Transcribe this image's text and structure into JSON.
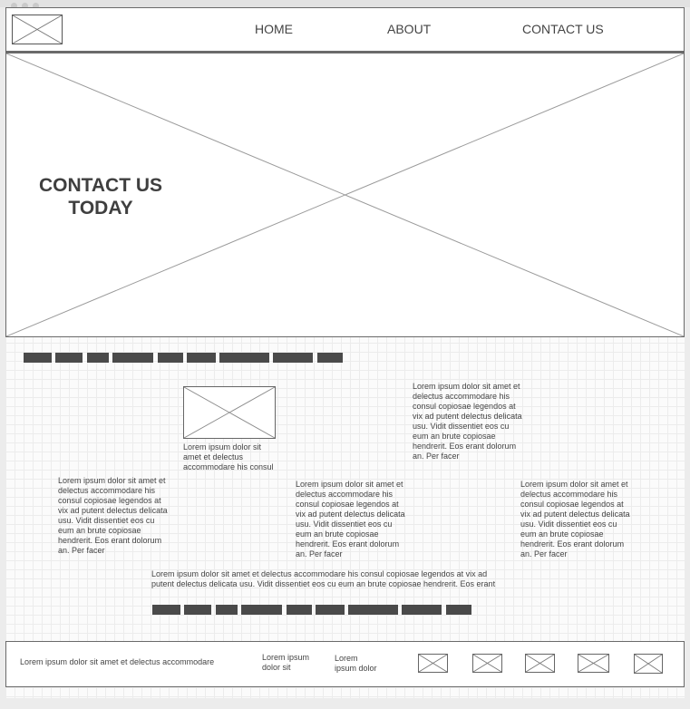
{
  "nav": {
    "home": "HOME",
    "about": "ABOUT",
    "contact": "CONTACT US"
  },
  "hero": {
    "title_line1": "CONTACT US",
    "title_line2": "TODAY"
  },
  "content": {
    "image_caption": "Lorem ipsum dolor sit amet et delectus accommodare his consul",
    "para_top_right": "Lorem ipsum dolor sit amet et delectus accommodare his consul copiosae legendos at vix ad putent delectus delicata usu. Vidit dissentiet eos cu eum an brute copiosae hendrerit. Eos erant dolorum an. Per facer",
    "para_left": "Lorem ipsum dolor sit amet et delectus accommodare his consul copiosae legendos at vix ad putent delectus delicata usu. Vidit dissentiet eos cu eum an brute copiosae hendrerit. Eos erant dolorum an. Per facer",
    "para_middle": "Lorem ipsum dolor sit amet et delectus accommodare his consul copiosae legendos at vix ad putent delectus delicata usu. Vidit dissentiet eos cu eum an brute copiosae hendrerit. Eos erant dolorum an. Per facer",
    "para_right": "Lorem ipsum dolor sit amet et delectus accommodare his consul copiosae legendos at vix ad putent delectus delicata usu. Vidit dissentiet eos cu eum an brute copiosae hendrerit. Eos erant dolorum an. Per facer",
    "para_wide": "Lorem ipsum dolor sit amet et delectus accommodare his consul copiosae legendos at vix ad putent delectus delicata usu. Vidit dissentiet eos cu eum an brute copiosae hendrerit. Eos erant"
  },
  "footer": {
    "text": "Lorem ipsum dolor sit amet et delectus accommodare",
    "col1": "Lorem ipsum dolor sit",
    "col2": "Lorem ipsum dolor"
  },
  "colors": {
    "background": "#ececec",
    "box_border": "#6a6a6a",
    "placeholder_bar": "#4a4a4a",
    "text": "#444444"
  },
  "icons": [
    "logo-placeholder-icon",
    "hero-image-placeholder-icon",
    "content-image-placeholder-icon",
    "social-icon-1",
    "social-icon-2",
    "social-icon-3",
    "social-icon-4",
    "social-icon-5"
  ]
}
